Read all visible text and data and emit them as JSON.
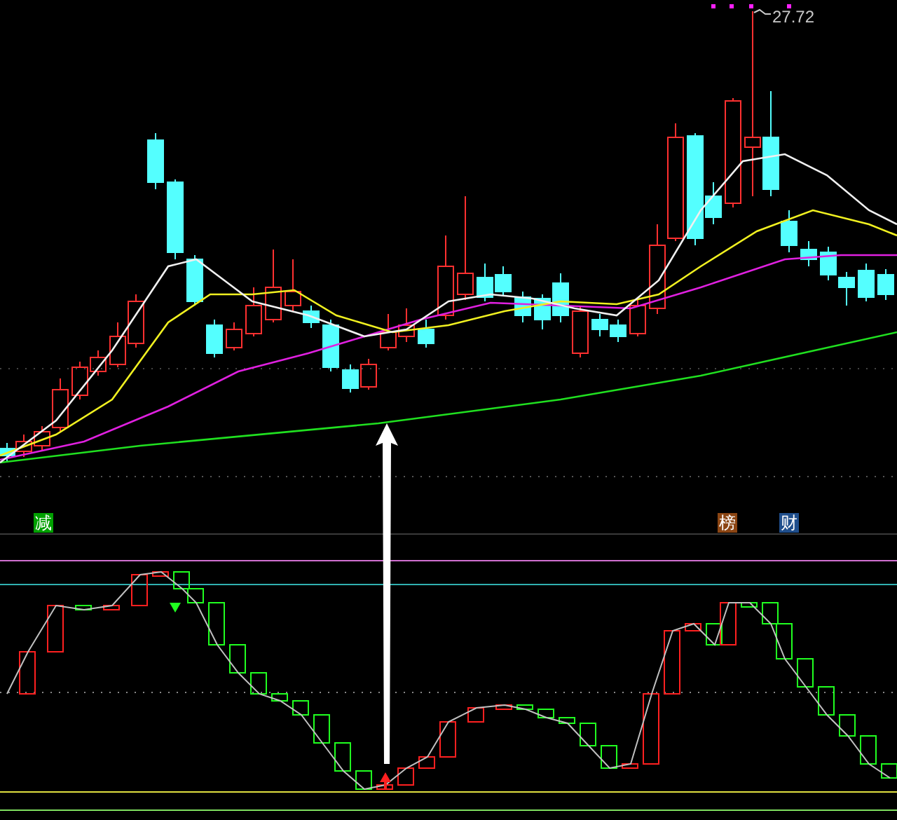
{
  "price_chart": {
    "high_label": "27.72"
  },
  "indicator_panel": {
    "signals": [
      {
        "label": "减",
        "color": "#00a000"
      },
      {
        "label": "榜",
        "color": "#8b4513"
      },
      {
        "label": "财",
        "color": "#1f4e8c"
      }
    ]
  }
}
